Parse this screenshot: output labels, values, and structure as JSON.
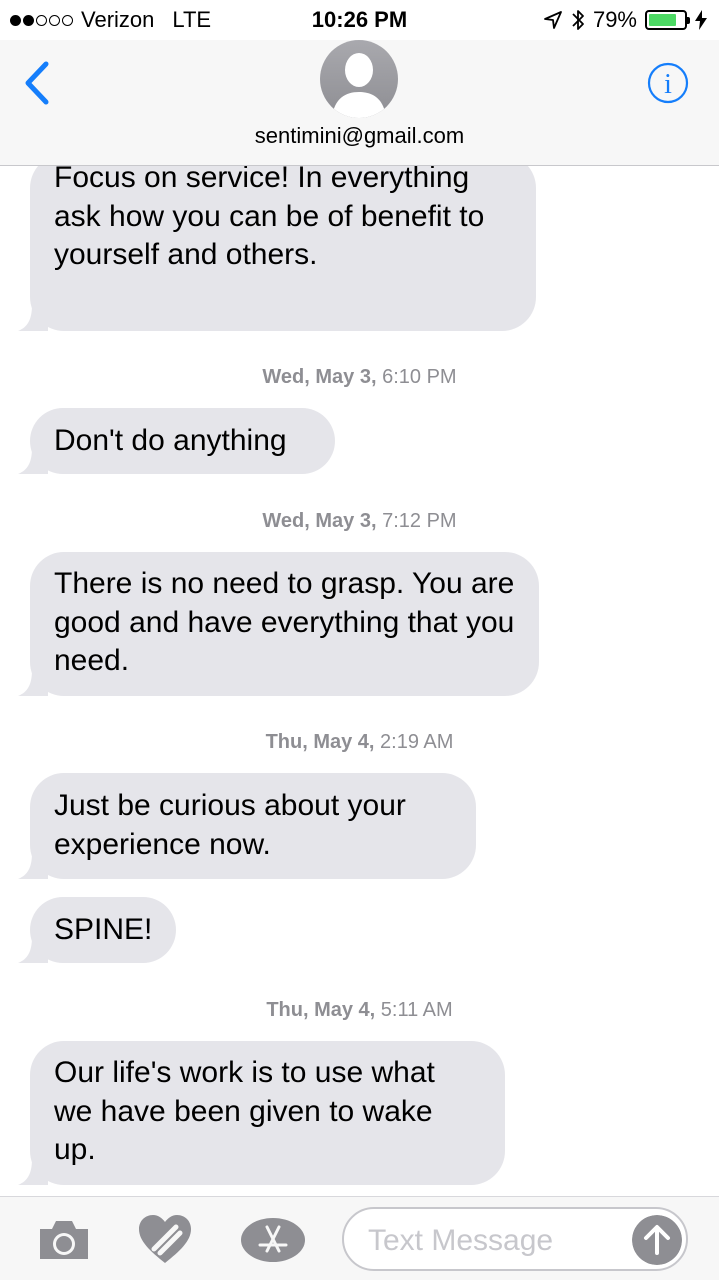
{
  "status_bar": {
    "carrier": "Verizon",
    "network": "LTE",
    "time": "10:26 PM",
    "battery_percent": "79%",
    "battery_level": 0.79,
    "signal_bars_filled": 2,
    "signal_bars_total": 5
  },
  "header": {
    "contact": "sentimini@gmail.com"
  },
  "messages": [
    {
      "type": "bubble",
      "text": "Focus on service!  In everything ask how you can be of benefit to yourself and others."
    },
    {
      "type": "timestamp",
      "day": "Wed, May 3,",
      "time": "6:10 PM"
    },
    {
      "type": "bubble",
      "text": "Don't do anything"
    },
    {
      "type": "timestamp",
      "day": "Wed, May 3,",
      "time": "7:12 PM"
    },
    {
      "type": "bubble",
      "text": "There is no need to grasp.  You are good and have everything that you need."
    },
    {
      "type": "timestamp",
      "day": "Thu, May 4,",
      "time": "2:19 AM"
    },
    {
      "type": "bubble",
      "text": "Just be curious about your experience now."
    },
    {
      "type": "bubble",
      "text": "SPINE!"
    },
    {
      "type": "timestamp",
      "day": "Thu, May 4,",
      "time": "5:11 AM"
    },
    {
      "type": "bubble",
      "text": "Our life's work is to use what we have been given to wake up."
    }
  ],
  "input": {
    "placeholder": "Text Message"
  },
  "icons": {
    "back": "chevron-left-icon",
    "info": "info-icon",
    "camera": "camera-icon",
    "digital_touch": "heart-hands-icon",
    "apps": "app-store-icon",
    "send": "send-arrow-icon"
  },
  "colors": {
    "accent": "#157efb",
    "bubble": "#e5e5ea",
    "timestamp": "#8e8e93",
    "battery": "#4cd964"
  }
}
